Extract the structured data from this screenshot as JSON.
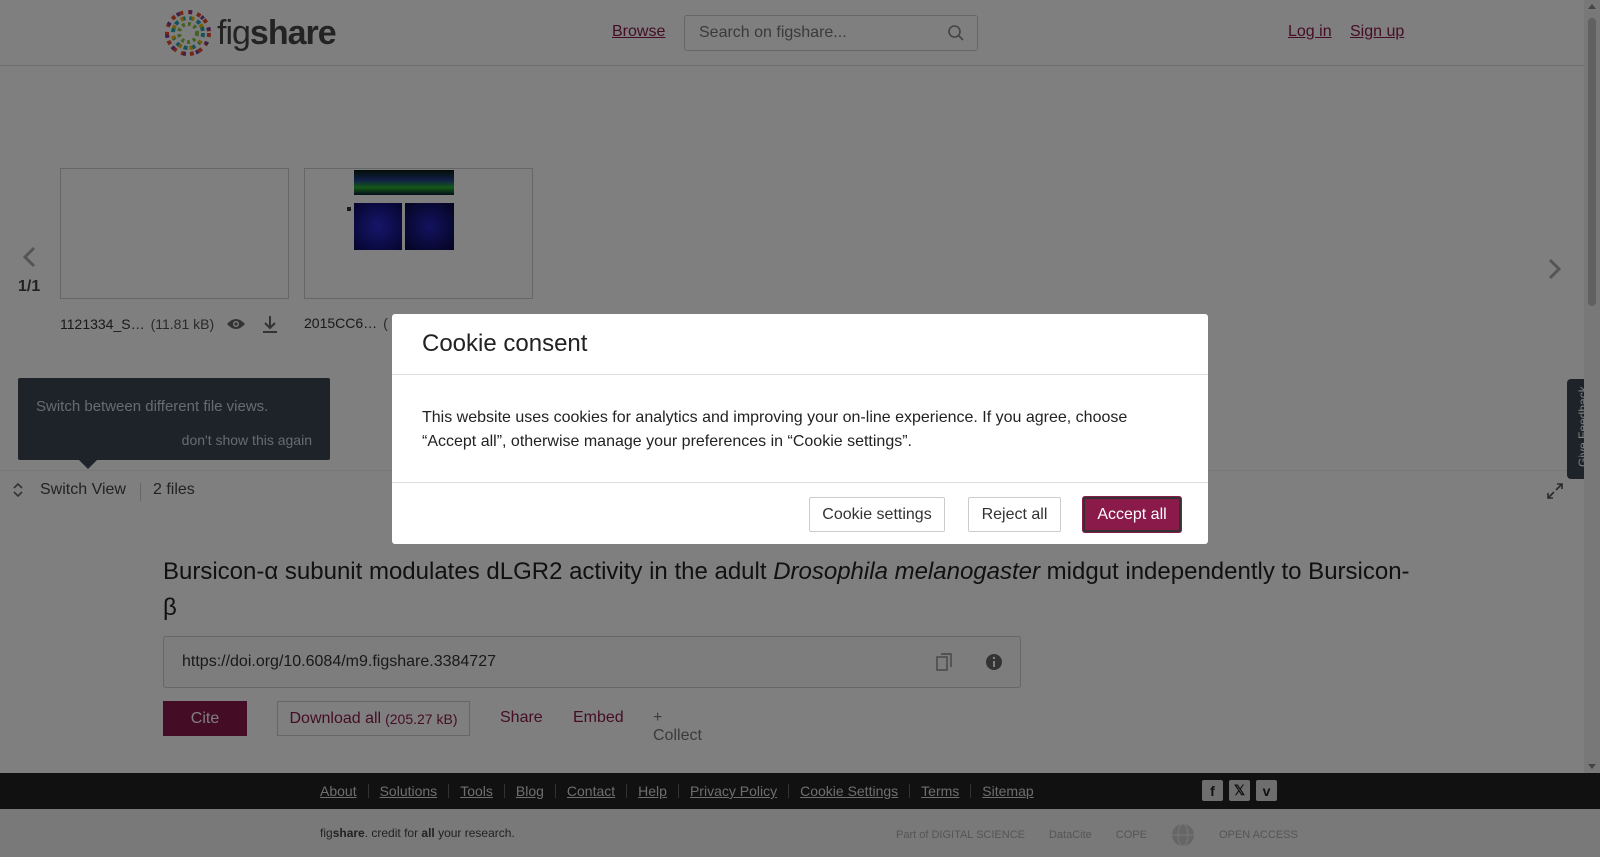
{
  "header": {
    "logo_text_light": "fig",
    "logo_text_bold": "share",
    "browse_label": "Browse",
    "search_placeholder": "Search on figshare...",
    "login_label": "Log in",
    "signup_label": "Sign up"
  },
  "viewer": {
    "counter": "1/1",
    "files": [
      {
        "name": "1121334_S…",
        "size": "(11.81 kB)"
      },
      {
        "name": "2015CC6…",
        "size": "("
      }
    ],
    "tooltip_text": "Switch between different file views.",
    "tooltip_dismiss": "don't show this again",
    "switch_view_label": "Switch View",
    "file_count": "2 files"
  },
  "feedback_label": "Give Feedback",
  "item": {
    "title_part1": "Bursicon-α subunit modulates dLGR2 activity in the adult ",
    "title_italic": "Drosophila melanogaster",
    "title_part2": " midgut independently to Bursicon-β",
    "doi": "https://doi.org/10.6084/m9.figshare.3384727",
    "cite_label": "Cite",
    "download_label": "Download all",
    "download_size": "(205.27 kB)",
    "share_label": "Share",
    "embed_label": "Embed",
    "collect_label": "+ Collect"
  },
  "footer": {
    "links": [
      "About",
      "Solutions",
      "Tools",
      "Blog",
      "Contact",
      "Help",
      "Privacy Policy",
      "Cookie Settings",
      "Terms",
      "Sitemap"
    ],
    "tagline_fig": "fig",
    "tagline_share": "share",
    "tagline_mid": ". credit for ",
    "tagline_all": "all",
    "tagline_end": " your research.",
    "partners": [
      "Part of DIGITAL SCIENCE",
      "DataCite",
      "COPE",
      "",
      "OPEN ACCESS"
    ]
  },
  "cookie_modal": {
    "title": "Cookie consent",
    "body": "This website uses cookies for analytics and improving your on-line experience. If you agree, choose “Accept all”, otherwise manage your preferences in “Cookie settings”.",
    "settings_label": "Cookie settings",
    "reject_label": "Reject all",
    "accept_label": "Accept all"
  },
  "colors": {
    "brand": "#8a1a4a",
    "footer_bg": "#222222",
    "tooltip_bg": "#3a4652"
  }
}
